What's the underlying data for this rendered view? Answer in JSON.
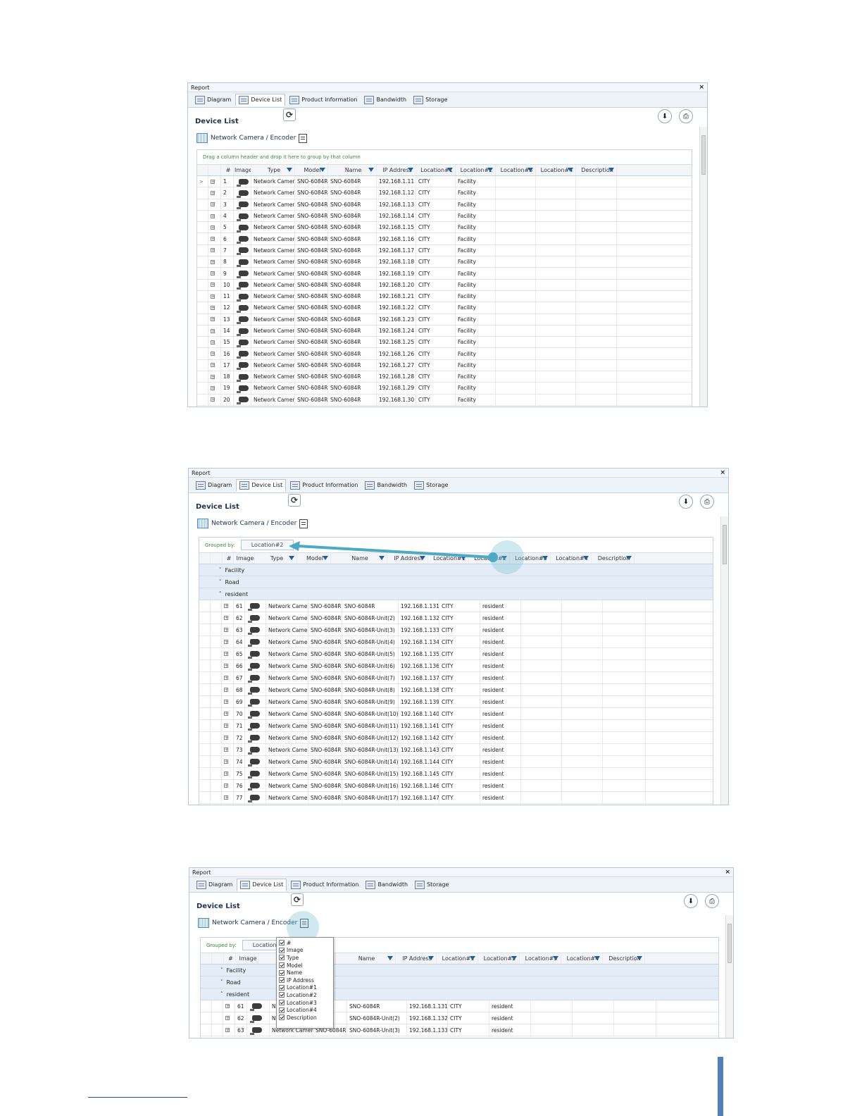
{
  "common": {
    "window_title": "Report",
    "close": "×",
    "tabs": [
      "Diagram",
      "Device List",
      "Product Information",
      "Bandwidth",
      "Storage"
    ],
    "heading": "Device List",
    "subheading": "Network Camera / Encoder",
    "refresh_glyph": "⟳",
    "export_glyph": "⬇",
    "print_glyph": "⎙",
    "row_type": "Network Camera",
    "row_model": "SNO-6084R",
    "row_loc1": "CITY"
  },
  "shot1": {
    "group_hint": "Drag a column header and drop it here to group by that column",
    "columns": [
      "#",
      "Image",
      "Type",
      "Model",
      "Name",
      "IP Address",
      "Location#1",
      "Location#2",
      "Location#3",
      "Location#4",
      "Description"
    ],
    "rows": [
      [
        "1",
        "SNO-6084R",
        "192.168.1.11",
        "Facility"
      ],
      [
        "2",
        "SNO-6084R",
        "192.168.1.12",
        "Facility"
      ],
      [
        "3",
        "SNO-6084R",
        "192.168.1.13",
        "Facility"
      ],
      [
        "4",
        "SNO-6084R",
        "192.168.1.14",
        "Facility"
      ],
      [
        "5",
        "SNO-6084R",
        "192.168.1.15",
        "Facility"
      ],
      [
        "6",
        "SNO-6084R",
        "192.168.1.16",
        "Facility"
      ],
      [
        "7",
        "SNO-6084R",
        "192.168.1.17",
        "Facility"
      ],
      [
        "8",
        "SNO-6084R",
        "192.168.1.18",
        "Facility"
      ],
      [
        "9",
        "SNO-6084R",
        "192.168.1.19",
        "Facility"
      ],
      [
        "10",
        "SNO-6084R",
        "192.168.1.20",
        "Facility"
      ],
      [
        "11",
        "SNO-6084R",
        "192.168.1.21",
        "Facility"
      ],
      [
        "12",
        "SNO-6084R",
        "192.168.1.22",
        "Facility"
      ],
      [
        "13",
        "SNO-6084R",
        "192.168.1.23",
        "Facility"
      ],
      [
        "14",
        "SNO-6084R",
        "192.168.1.24",
        "Facility"
      ],
      [
        "15",
        "SNO-6084R",
        "192.168.1.25",
        "Facility"
      ],
      [
        "16",
        "SNO-6084R",
        "192.168.1.26",
        "Facility"
      ],
      [
        "17",
        "SNO-6084R",
        "192.168.1.27",
        "Facility"
      ],
      [
        "18",
        "SNO-6084R",
        "192.168.1.28",
        "Facility"
      ],
      [
        "19",
        "SNO-6084R",
        "192.168.1.29",
        "Facility"
      ],
      [
        "20",
        "SNO-6084R",
        "192.168.1.30",
        "Facility"
      ]
    ]
  },
  "shot2": {
    "grouped_by_label": "Grouped by:",
    "grouped_chip": "Location#2",
    "columns": [
      "#",
      "Image",
      "Type",
      "Model",
      "Name",
      "IP Address",
      "Location#1",
      "Location#2",
      "Location#3",
      "Location#4",
      "Description"
    ],
    "groups": [
      {
        "chev": "˅",
        "name": "Facility"
      },
      {
        "chev": "˅",
        "name": "Road"
      },
      {
        "chev": "˄",
        "name": "resident"
      }
    ],
    "rows": [
      [
        "61",
        "SNO-6084R",
        "192.168.1.131",
        "resident"
      ],
      [
        "62",
        "SNO-6084R-Unit(2)",
        "192.168.1.132",
        "resident"
      ],
      [
        "63",
        "SNO-6084R-Unit(3)",
        "192.168.1.133",
        "resident"
      ],
      [
        "64",
        "SNO-6084R-Unit(4)",
        "192.168.1.134",
        "resident"
      ],
      [
        "65",
        "SNO-6084R-Unit(5)",
        "192.168.1.135",
        "resident"
      ],
      [
        "66",
        "SNO-6084R-Unit(6)",
        "192.168.1.136",
        "resident"
      ],
      [
        "67",
        "SNO-6084R-Unit(7)",
        "192.168.1.137",
        "resident"
      ],
      [
        "68",
        "SNO-6084R-Unit(8)",
        "192.168.1.138",
        "resident"
      ],
      [
        "69",
        "SNO-6084R-Unit(9)",
        "192.168.1.139",
        "resident"
      ],
      [
        "70",
        "SNO-6084R-Unit(10)",
        "192.168.1.140",
        "resident"
      ],
      [
        "71",
        "SNO-6084R-Unit(11)",
        "192.168.1.141",
        "resident"
      ],
      [
        "72",
        "SNO-6084R-Unit(12)",
        "192.168.1.142",
        "resident"
      ],
      [
        "73",
        "SNO-6084R-Unit(13)",
        "192.168.1.143",
        "resident"
      ],
      [
        "74",
        "SNO-6084R-Unit(14)",
        "192.168.1.144",
        "resident"
      ],
      [
        "75",
        "SNO-6084R-Unit(15)",
        "192.168.1.145",
        "resident"
      ],
      [
        "76",
        "SNO-6084R-Unit(16)",
        "192.168.1.146",
        "resident"
      ],
      [
        "77",
        "SNO-6084R-Unit(17)",
        "192.168.1.147",
        "resident"
      ]
    ]
  },
  "shot3": {
    "grouped_by_label": "Grouped by:",
    "grouped_chip": "Location",
    "columns": [
      "#",
      "Image",
      "",
      "el",
      "Name",
      "IP Address",
      "Location#1",
      "Location#2",
      "Location#3",
      "Location#4",
      "Description"
    ],
    "groups": [
      {
        "chev": "˅",
        "name": "Facility"
      },
      {
        "chev": "˅",
        "name": "Road"
      },
      {
        "chev": "˄",
        "name": "resident"
      }
    ],
    "rows": [
      [
        "61",
        "N",
        "6084R",
        "SNO-6084R",
        "192.168.1.131",
        "CITY",
        "resident"
      ],
      [
        "62",
        "N",
        "6084R",
        "SNO-6084R-Unit(2)",
        "192.168.1.132",
        "CITY",
        "resident"
      ],
      [
        "63",
        "Network Camera",
        "SNO-6084R",
        "SNO-6084R-Unit(3)",
        "192.168.1.133",
        "CITY",
        "resident"
      ]
    ],
    "column_chooser": [
      "#",
      "Image",
      "Type",
      "Model",
      "Name",
      "IP Address",
      "Location#1",
      "Location#2",
      "Location#3",
      "Location#4",
      "Description"
    ]
  },
  "colors": {
    "accent": "#4ea9c4",
    "header_text": "#1e3350",
    "group_row": "#e4edf7",
    "filter": "#1b5ea8"
  }
}
